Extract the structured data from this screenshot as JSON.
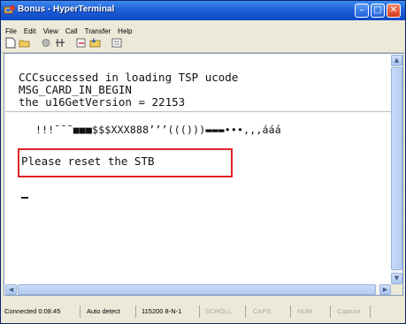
{
  "window": {
    "title": "Bonus - HyperTerminal",
    "minimize_glyph": "–",
    "maximize_glyph": "□",
    "close_glyph": "✕"
  },
  "menu": [
    "File",
    "Edit",
    "View",
    "Call",
    "Transfer",
    "Help"
  ],
  "toolbar": {
    "icons": [
      "new-connection-icon",
      "open-icon",
      "call-icon",
      "disconnect-icon",
      "send-icon",
      "receive-icon",
      "properties-icon"
    ]
  },
  "terminal": {
    "lines": [
      "CCCsuccessed in loading TSP ucode",
      "MSG_CARD_IN_BEGIN",
      "the u16GetVersion = 22153"
    ],
    "garbled_line": "!!!¯¯¯■■■$$$XXX888’’’((()))▬▬▬•••,,,ááá",
    "highlighted_message": "Please reset the STB",
    "cursor": "_"
  },
  "colors": {
    "title_bar": "#1f5fd6",
    "highlight_border": "#e0222a",
    "chrome": "#ece9d8"
  },
  "status": {
    "connected": "Connected 0:08:45",
    "detect": "Auto detect",
    "settings": "115200 8-N-1",
    "scroll": "SCROLL",
    "caps": "CAPS",
    "num": "NUM",
    "capture": "Capture"
  }
}
